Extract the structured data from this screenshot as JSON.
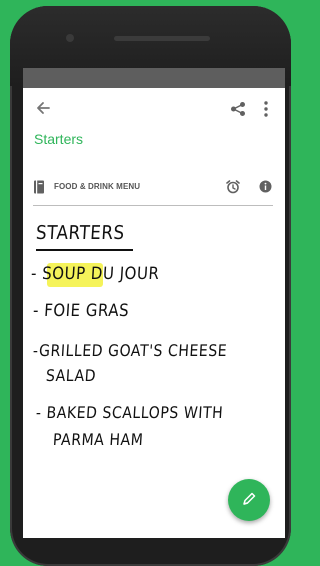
{
  "header": {
    "back_icon": "arrow-back-icon",
    "share_icon": "share-icon",
    "more_icon": "more-vert-icon"
  },
  "notebook": {
    "name": "Starters"
  },
  "note_meta": {
    "notebook_icon": "notebook-icon",
    "title": "FOOD & DRINK MENU",
    "alarm_icon": "alarm-icon",
    "info_icon": "info-icon"
  },
  "handwriting": {
    "title": "STARTERS",
    "lines": [
      "- SOUP DU JOUR",
      "- FOIE GRAS",
      "-GRILLED GOAT'S CHEESE",
      "SALAD",
      "- BAKED SCALLOPS WITH",
      "PARMA HAM"
    ],
    "highlight_color": "#f5f35a"
  },
  "fab": {
    "icon": "pencil-icon"
  },
  "colors": {
    "accent": "#2fb55a",
    "status_bar": "#5e5e5e"
  }
}
